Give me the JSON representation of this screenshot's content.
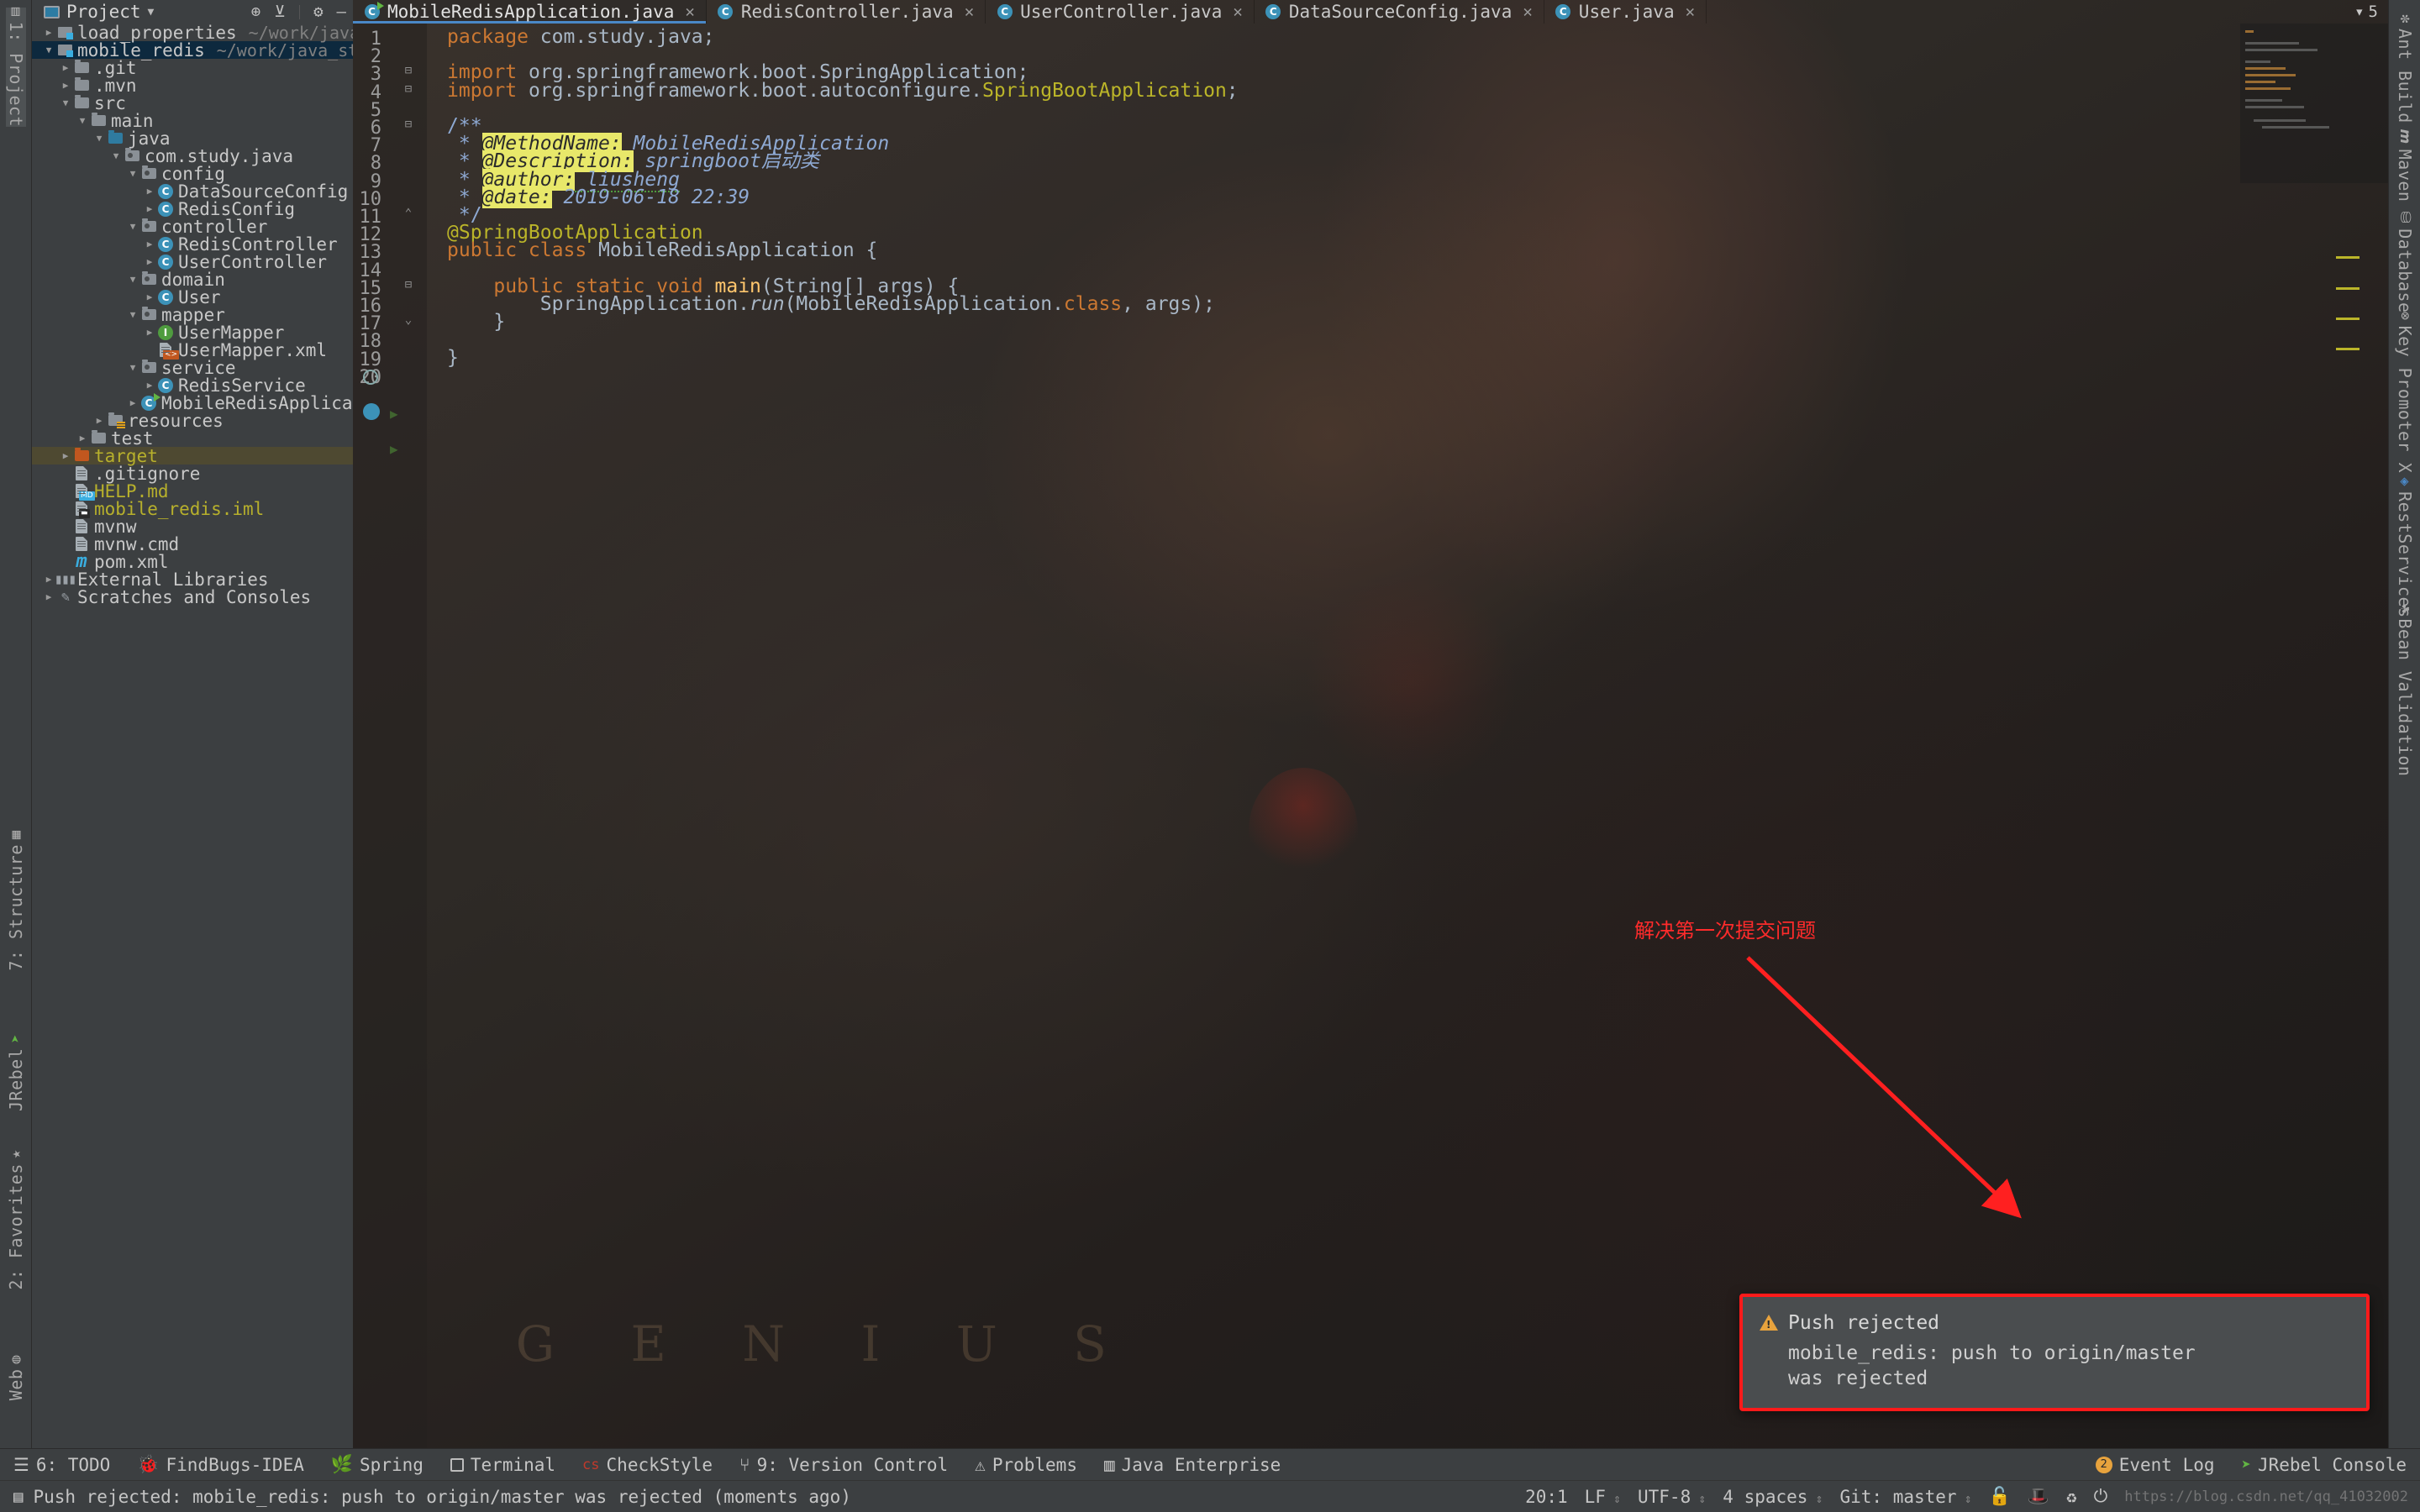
{
  "window": {
    "ide": "IntelliJ IDEA"
  },
  "left_strip": [
    {
      "label": "1: Project",
      "icon": "project-icon",
      "active": true
    },
    {
      "label": "7: Structure",
      "icon": "structure-icon",
      "active": false
    },
    {
      "label": "JRebel",
      "icon": "jrebel-icon",
      "active": false
    },
    {
      "label": "2: Favorites",
      "icon": "star-icon",
      "active": false
    },
    {
      "label": "Web",
      "icon": "web-icon",
      "active": false
    }
  ],
  "right_strip": [
    {
      "label": "Ant Build",
      "icon": "ant-icon"
    },
    {
      "label": "Maven",
      "icon": "maven-icon"
    },
    {
      "label": "Database",
      "icon": "database-icon"
    },
    {
      "label": "Key Promoter X",
      "icon": "key-promoter-icon"
    },
    {
      "label": "RestServices",
      "icon": "rest-services-icon"
    },
    {
      "label": "Bean Validation",
      "icon": "bean-validation-icon"
    }
  ],
  "project_panel": {
    "title": "Project",
    "toolbar": [
      "locate-icon",
      "collapse-all-icon",
      "settings-icon",
      "hide-icon"
    ],
    "tree": [
      {
        "depth": 0,
        "arrow": "collapsed",
        "icon": "module-folder",
        "label": "load_properties",
        "sub": "~/work/java_study/load_p",
        "selected": ""
      },
      {
        "depth": 0,
        "arrow": "expanded",
        "icon": "module-folder",
        "label": "mobile_redis",
        "sub": "~/work/java_study/mobile_re",
        "selected": "blue"
      },
      {
        "depth": 1,
        "arrow": "collapsed",
        "icon": "folder-grey",
        "label": ".git",
        "sub": "",
        "selected": ""
      },
      {
        "depth": 1,
        "arrow": "collapsed",
        "icon": "folder-grey",
        "label": ".mvn",
        "sub": "",
        "selected": ""
      },
      {
        "depth": 1,
        "arrow": "expanded",
        "icon": "folder-grey",
        "label": "src",
        "sub": "",
        "selected": ""
      },
      {
        "depth": 2,
        "arrow": "expanded",
        "icon": "folder-grey",
        "label": "main",
        "sub": "",
        "selected": ""
      },
      {
        "depth": 3,
        "arrow": "expanded",
        "icon": "folder-blue",
        "label": "java",
        "sub": "",
        "selected": ""
      },
      {
        "depth": 4,
        "arrow": "expanded",
        "icon": "folder-package",
        "label": "com.study.java",
        "sub": "",
        "selected": ""
      },
      {
        "depth": 5,
        "arrow": "expanded",
        "icon": "folder-package",
        "label": "config",
        "sub": "",
        "selected": ""
      },
      {
        "depth": 6,
        "arrow": "collapsed",
        "icon": "java-class",
        "label": "DataSourceConfig",
        "sub": "",
        "selected": ""
      },
      {
        "depth": 6,
        "arrow": "collapsed",
        "icon": "java-class",
        "label": "RedisConfig",
        "sub": "",
        "selected": ""
      },
      {
        "depth": 5,
        "arrow": "expanded",
        "icon": "folder-package",
        "label": "controller",
        "sub": "",
        "selected": ""
      },
      {
        "depth": 6,
        "arrow": "collapsed",
        "icon": "java-class",
        "label": "RedisController",
        "sub": "",
        "selected": ""
      },
      {
        "depth": 6,
        "arrow": "collapsed",
        "icon": "java-class",
        "label": "UserController",
        "sub": "",
        "selected": ""
      },
      {
        "depth": 5,
        "arrow": "expanded",
        "icon": "folder-package",
        "label": "domain",
        "sub": "",
        "selected": ""
      },
      {
        "depth": 6,
        "arrow": "collapsed",
        "icon": "java-class",
        "label": "User",
        "sub": "",
        "selected": ""
      },
      {
        "depth": 5,
        "arrow": "expanded",
        "icon": "folder-package",
        "label": "mapper",
        "sub": "",
        "selected": ""
      },
      {
        "depth": 6,
        "arrow": "collapsed",
        "icon": "java-interface",
        "label": "UserMapper",
        "sub": "",
        "selected": ""
      },
      {
        "depth": 6,
        "arrow": "none",
        "icon": "xml-file",
        "label": "UserMapper.xml",
        "sub": "",
        "selected": ""
      },
      {
        "depth": 5,
        "arrow": "expanded",
        "icon": "folder-package",
        "label": "service",
        "sub": "",
        "selected": ""
      },
      {
        "depth": 6,
        "arrow": "collapsed",
        "icon": "java-class",
        "label": "RedisService",
        "sub": "",
        "selected": ""
      },
      {
        "depth": 5,
        "arrow": "collapsed",
        "icon": "java-runnable",
        "label": "MobileRedisApplication",
        "sub": "",
        "selected": ""
      },
      {
        "depth": 3,
        "arrow": "collapsed",
        "icon": "folder-resources",
        "label": "resources",
        "sub": "",
        "selected": ""
      },
      {
        "depth": 2,
        "arrow": "collapsed",
        "icon": "folder-grey",
        "label": "test",
        "sub": "",
        "selected": ""
      },
      {
        "depth": 1,
        "arrow": "collapsed",
        "icon": "folder-orange",
        "label": "target",
        "sub": "",
        "selected": "olive",
        "yellow": true
      },
      {
        "depth": 1,
        "arrow": "none",
        "icon": "file-doc",
        "label": ".gitignore",
        "sub": "",
        "selected": ""
      },
      {
        "depth": 1,
        "arrow": "none",
        "icon": "md-file",
        "label": "HELP.md",
        "sub": "",
        "selected": "",
        "yellow": true
      },
      {
        "depth": 1,
        "arrow": "none",
        "icon": "iml-file",
        "label": "mobile_redis.iml",
        "sub": "",
        "selected": "",
        "yellow": true
      },
      {
        "depth": 1,
        "arrow": "none",
        "icon": "file-doc",
        "label": "mvnw",
        "sub": "",
        "selected": ""
      },
      {
        "depth": 1,
        "arrow": "none",
        "icon": "file-doc",
        "label": "mvnw.cmd",
        "sub": "",
        "selected": ""
      },
      {
        "depth": 1,
        "arrow": "none",
        "icon": "maven-pom",
        "label": "pom.xml",
        "sub": "",
        "selected": ""
      },
      {
        "depth": 0,
        "arrow": "collapsed",
        "icon": "libraries",
        "label": "External Libraries",
        "sub": "",
        "selected": ""
      },
      {
        "depth": 0,
        "arrow": "collapsed",
        "icon": "scratches",
        "label": "Scratches and Consoles",
        "sub": "",
        "selected": ""
      }
    ]
  },
  "editor": {
    "tabs": [
      {
        "label": "MobileRedisApplication.java",
        "icon": "java-runnable",
        "active": true,
        "closable": true
      },
      {
        "label": "RedisController.java",
        "icon": "java-class",
        "active": false,
        "closable": true
      },
      {
        "label": "UserController.java",
        "icon": "java-class",
        "active": false,
        "closable": true
      },
      {
        "label": "DataSourceConfig.java",
        "icon": "java-class",
        "active": false,
        "closable": true
      },
      {
        "label": "User.java",
        "icon": "java-class",
        "active": false,
        "closable": true
      }
    ],
    "tab_overflow": "5",
    "line_numbers": [
      "1",
      "2",
      "3",
      "4",
      "5",
      "6",
      "7",
      "8",
      "9",
      "10",
      "11",
      "12",
      "13",
      "14",
      "15",
      "16",
      "17",
      "18",
      "19",
      "20"
    ],
    "lines": [
      "package com.study.java;",
      "",
      "import org.springframework.boot.SpringApplication;",
      "import org.springframework.boot.autoconfigure.SpringBootApplication;",
      "",
      "/**",
      " * @MethodName: MobileRedisApplication",
      " * @Description: springboot启动类",
      " * @author: liusheng",
      " * @date: 2019-06-18 22:39",
      " */",
      "@SpringBootApplication",
      "public class MobileRedisApplication {",
      "",
      "    public static void main(String[] args) {",
      "        SpringApplication.run(MobileRedisApplication.class, args);",
      "    }",
      "",
      "}",
      ""
    ],
    "javadoc": {
      "method_name_tag": "@MethodName:",
      "method_name_value": "MobileRedisApplication",
      "description_tag": "@Description:",
      "description_value": "springboot启动类",
      "author_tag": "@author:",
      "author_value": "liusheng",
      "date_tag": "@date:",
      "date_value": "2019-06-18 22:39"
    }
  },
  "annotation": {
    "note": "解决第一次提交问题",
    "arrow_color": "#ff2020"
  },
  "popup": {
    "title": "Push rejected",
    "line1": "mobile_redis: push to origin/master",
    "line2": "was rejected",
    "icon": "warning-icon",
    "border_color": "#ff1a1a"
  },
  "bottom_toolbar": [
    {
      "label": "6: TODO",
      "icon": "todo-icon",
      "mnemonic": "6"
    },
    {
      "label": "FindBugs-IDEA",
      "icon": "findbugs-icon"
    },
    {
      "label": "Spring",
      "icon": "spring-icon"
    },
    {
      "label": "Terminal",
      "icon": "terminal-icon"
    },
    {
      "label": "CheckStyle",
      "icon": "checkstyle-icon"
    },
    {
      "label": "9: Version Control",
      "icon": "version-control-icon",
      "mnemonic": "9"
    },
    {
      "label": "Problems",
      "icon": "problems-icon"
    },
    {
      "label": "Java Enterprise",
      "icon": "java-enterprise-icon"
    }
  ],
  "bottom_toolbar_right": [
    {
      "label": "Event Log",
      "icon": "event-log-icon",
      "badge": "2"
    },
    {
      "label": "JRebel Console",
      "icon": "jrebel-icon"
    }
  ],
  "status_bar": {
    "message": "Push rejected: mobile_redis: push to origin/master was rejected (moments ago)",
    "message_icon": "notification-icon",
    "caret": "20:1",
    "line_sep": "LF",
    "encoding": "UTF-8",
    "indent": "4 spaces",
    "branch": "Git: master",
    "icons": [
      "lock-icon",
      "hat-icon",
      "sync-icon",
      "power-save-icon"
    ],
    "watermark": "https://blog.csdn.net/qq_41032002"
  }
}
